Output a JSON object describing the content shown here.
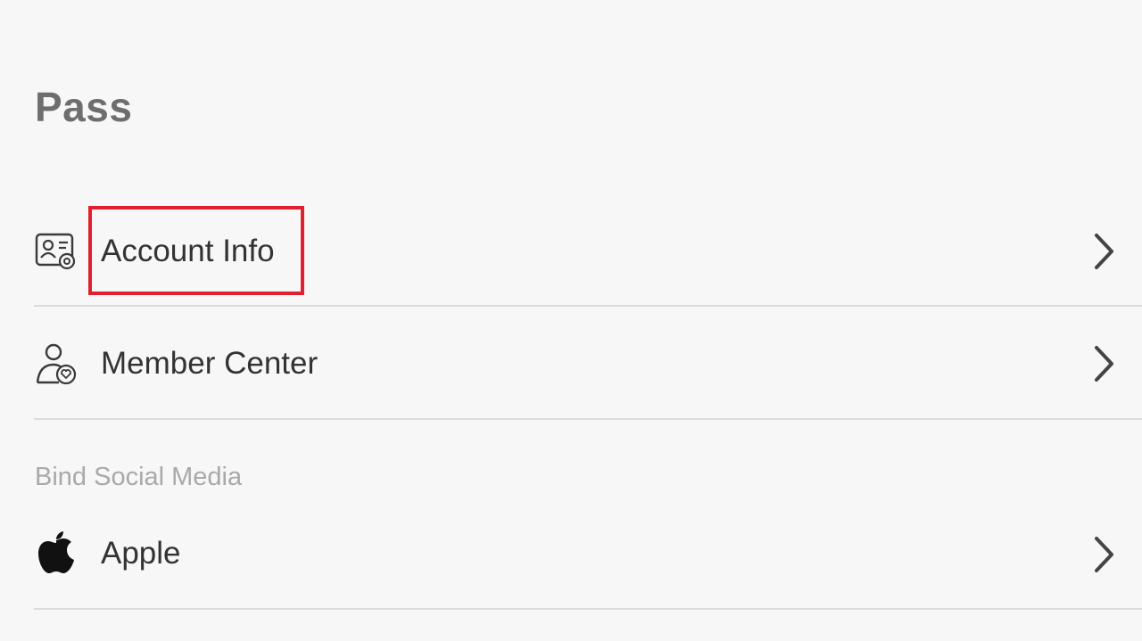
{
  "page": {
    "title": "Pass"
  },
  "rows": [
    {
      "label": "Account Info",
      "icon": "account-info-icon"
    },
    {
      "label": "Member Center",
      "icon": "member-center-icon"
    }
  ],
  "bind_section": {
    "header": "Bind Social Media",
    "items": [
      {
        "label": "Apple",
        "icon": "apple-logo-icon"
      }
    ]
  },
  "colors": {
    "background": "#f7f7f7",
    "title": "#6e6e6e",
    "text": "#333333",
    "section_header": "#a9a9a9",
    "divider": "#dcdcdc",
    "highlight": "#e0202e"
  }
}
